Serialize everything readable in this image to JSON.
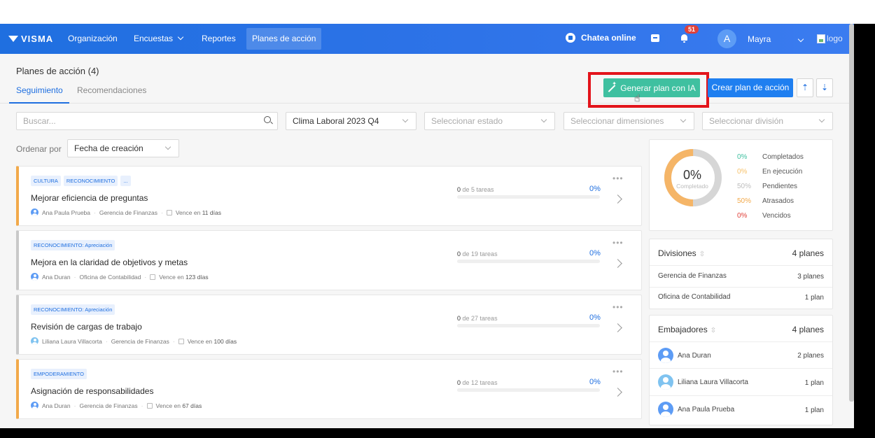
{
  "nav": {
    "brand": "VISMA",
    "items": [
      {
        "label": "Organización"
      },
      {
        "label": "Encuestas"
      },
      {
        "label": "Reportes"
      },
      {
        "label": "Planes de acción"
      }
    ],
    "chat_label": "Chatea online",
    "notifications_count": "51",
    "user_initial": "A",
    "user_name": "Mayra",
    "logo_alt": "logo"
  },
  "header": {
    "title": "Planes de acción (4)",
    "tabs": [
      {
        "label": "Seguimiento"
      },
      {
        "label": "Recomendaciones"
      }
    ],
    "generate_ai_label": "Generar plan con IA",
    "create_label": "Crear plan de acción"
  },
  "filters": {
    "search_placeholder": "Buscar...",
    "survey_value": "Clima Laboral 2023 Q4",
    "state_placeholder": "Seleccionar estado",
    "dimensions_placeholder": "Seleccionar dimensiones",
    "division_placeholder": "Seleccionar división"
  },
  "sort": {
    "label": "Ordenar por",
    "value": "Fecha de creación"
  },
  "plans": [
    {
      "tags": [
        "CULTURA",
        "RECONOCIMIENTO",
        "..."
      ],
      "title": "Mejorar eficiencia de preguntas",
      "owner": "Ana Paula Prueba",
      "division": "Gerencia de Finanzas",
      "due_prefix": "Vence en",
      "due": "11 días",
      "tasks_done": "0",
      "tasks_total": "de 5 tareas",
      "percent": "0%",
      "accent": "#f2a94a"
    },
    {
      "tags": [
        "RECONOCIMIENTO: Apreciación"
      ],
      "title": "Mejora en la claridad de objetivos y metas",
      "owner": "Ana Duran",
      "division": "Oficina de Contabilidad",
      "due_prefix": "Vence en",
      "due": "123 días",
      "tasks_done": "0",
      "tasks_total": "de 19 tareas",
      "percent": "0%",
      "accent": "#c9c9c9"
    },
    {
      "tags": [
        "RECONOCIMIENTO: Apreciación"
      ],
      "title": "Revisión de cargas de trabajo",
      "owner": "Liliana Laura Villacorta",
      "division": "Gerencia de Finanzas",
      "due_prefix": "Vence en",
      "due": "100 días",
      "tasks_done": "0",
      "tasks_total": "de 27 tareas",
      "percent": "0%",
      "accent": "#c9c9c9"
    },
    {
      "tags": [
        "EMPODERAMIENTO"
      ],
      "title": "Asignación de responsabilidades",
      "owner": "Ana Duran",
      "division": "Gerencia de Finanzas",
      "due_prefix": "Vence en",
      "due": "67 días",
      "tasks_done": "0",
      "tasks_total": "de 12 tareas",
      "percent": "0%",
      "accent": "#f2a94a"
    }
  ],
  "summary": {
    "center_value": "0%",
    "center_label": "Completado",
    "legend": [
      {
        "pct": "0%",
        "label": "Completados",
        "color": "#3fc0a0"
      },
      {
        "pct": "0%",
        "label": "En ejecución",
        "color": "#f7c26b"
      },
      {
        "pct": "50%",
        "label": "Pendientes",
        "color": "#bdbdbd"
      },
      {
        "pct": "50%",
        "label": "Atrasados",
        "color": "#f2a94a"
      },
      {
        "pct": "0%",
        "label": "Vencidos",
        "color": "#e0413a"
      }
    ]
  },
  "divisions": {
    "title": "Divisiones",
    "total": "4 planes",
    "rows": [
      {
        "name": "Gerencia de Finanzas",
        "count": "3 planes"
      },
      {
        "name": "Oficina de Contabilidad",
        "count": "1 plan"
      }
    ]
  },
  "ambassadors": {
    "title": "Embajadores",
    "total": "4 planes",
    "rows": [
      {
        "name": "Ana Duran",
        "count": "2 planes"
      },
      {
        "name": "Liliana Laura Villacorta",
        "count": "1 plan"
      },
      {
        "name": "Ana Paula Prueba",
        "count": "1 plan"
      }
    ]
  }
}
